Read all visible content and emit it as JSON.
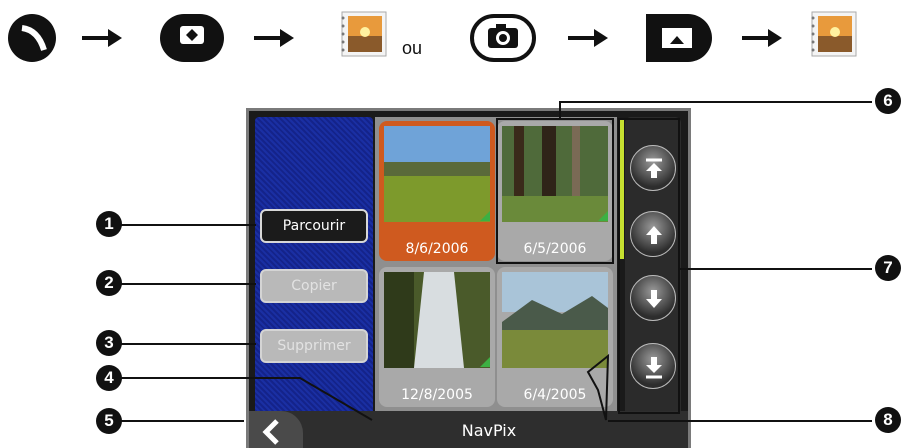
{
  "flow": {
    "ou": "ou",
    "icons": [
      "route-icon",
      "camera-settings-icon",
      "photo-album-icon",
      "camera-icon",
      "gallery-icon",
      "photo-album-icon"
    ]
  },
  "screen": {
    "buttons": {
      "browse": "Parcourir",
      "copy": "Copier",
      "delete": "Supprimer"
    },
    "thumbnails": [
      {
        "date": "8/6/2006",
        "selected": true
      },
      {
        "date": "6/5/2006",
        "selected": false
      },
      {
        "date": "12/8/2005",
        "selected": false
      },
      {
        "date": "6/4/2005",
        "selected": false
      }
    ],
    "title": "NavPix"
  },
  "callouts": [
    "1",
    "2",
    "3",
    "4",
    "5",
    "6",
    "7",
    "8"
  ]
}
